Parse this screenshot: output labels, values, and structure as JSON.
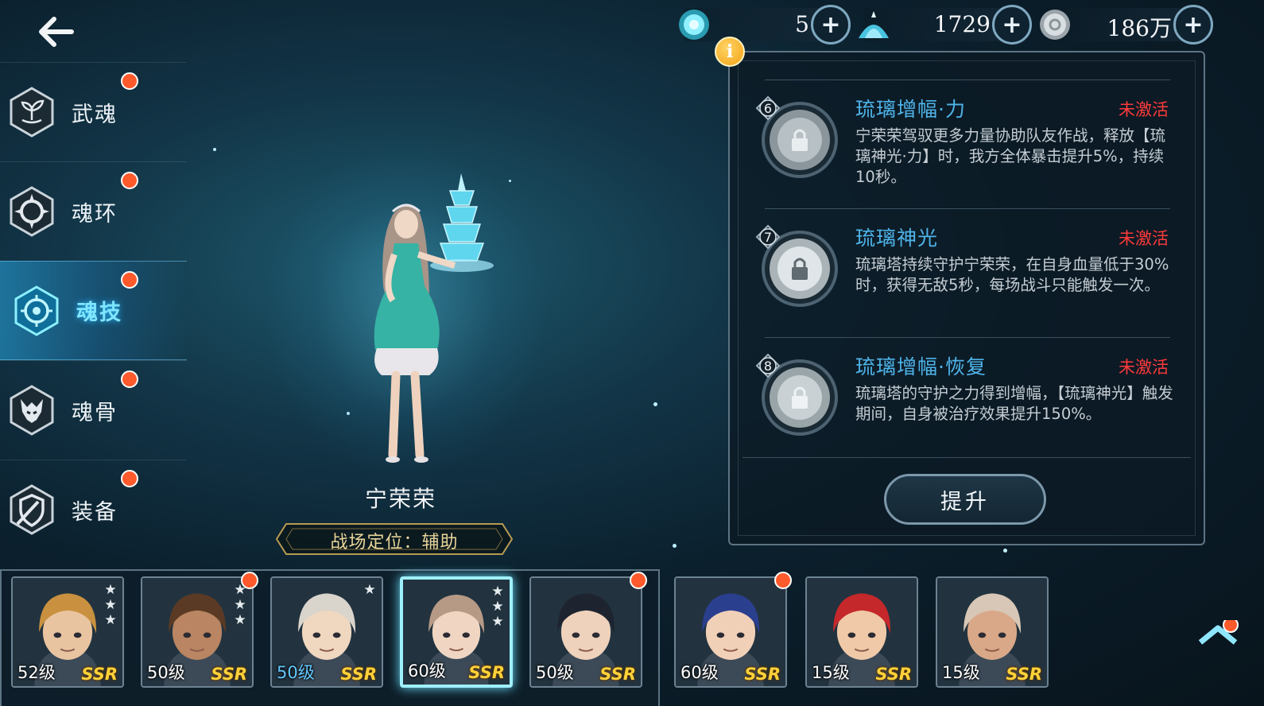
{
  "resources": [
    {
      "icon": "soul-crystal-icon",
      "value": "5"
    },
    {
      "icon": "diamond-pile-icon",
      "value": "1729"
    },
    {
      "icon": "silver-coin-icon",
      "value": "186万"
    }
  ],
  "plus_label": "+",
  "sidebar": {
    "items": [
      {
        "label": "武魂",
        "icon": "sprout-icon",
        "dot": true,
        "active": false
      },
      {
        "label": "魂环",
        "icon": "ring-icon",
        "dot": true,
        "active": false
      },
      {
        "label": "魂技",
        "icon": "skill-target-icon",
        "dot": true,
        "active": true
      },
      {
        "label": "魂骨",
        "icon": "beast-skull-icon",
        "dot": true,
        "active": false
      },
      {
        "label": "装备",
        "icon": "shield-icon",
        "dot": true,
        "active": false
      }
    ]
  },
  "character": {
    "name": "宁荣荣",
    "role": "战场定位：辅助"
  },
  "info_badge": "i",
  "skills": [
    {
      "number": "6",
      "name": "琉璃增幅·力",
      "status": "未激活",
      "desc": "宁荣荣驾驭更多力量协助队友作战，释放【琉璃神光·力】时，我方全体暴击提升5%，持续10秒。"
    },
    {
      "number": "7",
      "name": "琉璃神光",
      "status": "未激活",
      "desc": "琉璃塔持续守护宁荣荣，在自身血量低于30%时，获得无敌5秒，每场战斗只能触发一次。"
    },
    {
      "number": "8",
      "name": "琉璃增幅·恢复",
      "status": "未激活",
      "desc": "琉璃塔的守护之力得到增幅，【琉璃神光】触发期间，自身被治疗效果提升150%。"
    }
  ],
  "upgrade_button": "提升",
  "roster": [
    {
      "level": "52级",
      "rarity": "SSR",
      "stars": 3,
      "dot": false,
      "selected": false,
      "level_blue": false,
      "hair": "#c9913f",
      "skin": "#e9c4a1"
    },
    {
      "level": "50级",
      "rarity": "SSR",
      "stars": 3,
      "dot": true,
      "selected": false,
      "level_blue": false,
      "hair": "#5a3a24",
      "skin": "#b98562"
    },
    {
      "level": "50级",
      "rarity": "SSR",
      "stars": 1,
      "dot": false,
      "selected": false,
      "level_blue": true,
      "hair": "#d9d4cc",
      "skin": "#efd7c0"
    },
    {
      "level": "60级",
      "rarity": "SSR",
      "stars": 3,
      "dot": false,
      "selected": true,
      "level_blue": false,
      "hair": "#b79a86",
      "skin": "#f0d6c2"
    },
    {
      "level": "50级",
      "rarity": "SSR",
      "stars": 0,
      "dot": true,
      "selected": false,
      "level_blue": false,
      "hair": "#1d2430",
      "skin": "#efd2bb"
    },
    {
      "level": "60级",
      "rarity": "SSR",
      "stars": 0,
      "dot": true,
      "selected": false,
      "level_blue": false,
      "hair": "#2b3f8f",
      "skin": "#f1d0b8"
    },
    {
      "level": "15级",
      "rarity": "SSR",
      "stars": 0,
      "dot": false,
      "selected": false,
      "level_blue": false,
      "hair": "#c4282a",
      "skin": "#efc9a8"
    },
    {
      "level": "15级",
      "rarity": "SSR",
      "stars": 0,
      "dot": false,
      "selected": false,
      "level_blue": false,
      "hair": "#d8c7b6",
      "skin": "#d9a888"
    }
  ],
  "colors": {
    "accent": "#4fb4ea",
    "inactive": "#ff3a3a",
    "notification": "#ff5a2c",
    "rarity": "#ffd23a"
  }
}
